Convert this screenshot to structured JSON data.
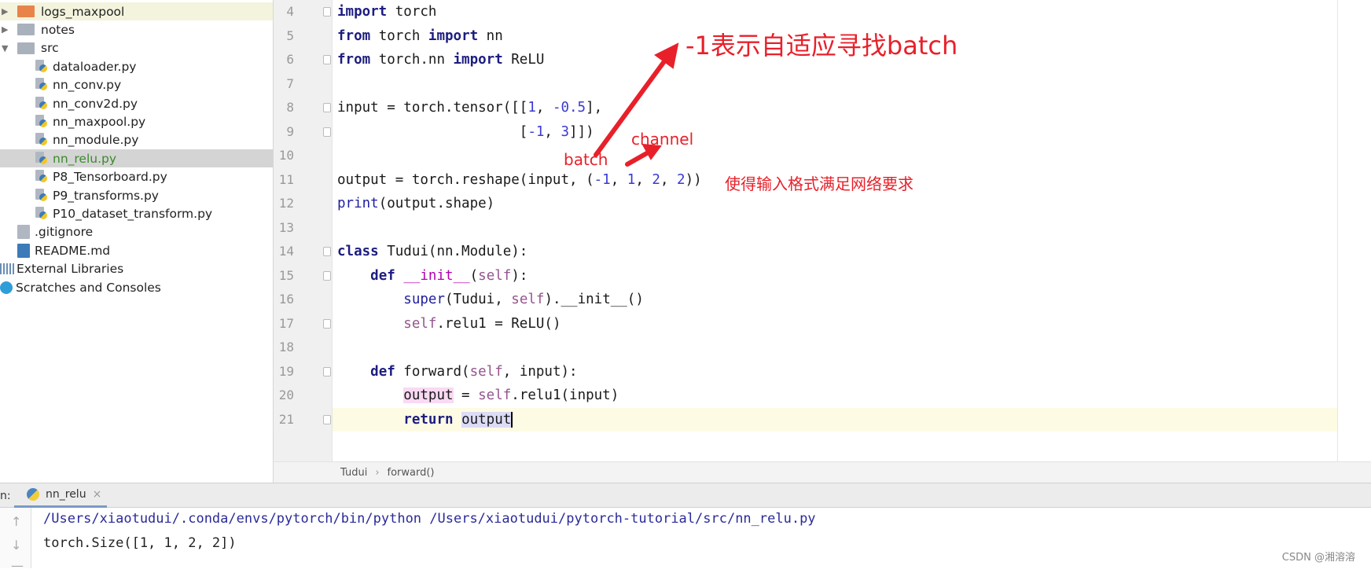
{
  "sidebar": {
    "items": [
      {
        "label": "logs_maxpool",
        "type": "folder",
        "color": "#e8844a",
        "expanded": false,
        "depth": 0,
        "highlight": true
      },
      {
        "label": "notes",
        "type": "folder",
        "color": "#a9b1bc",
        "expanded": false,
        "depth": 0
      },
      {
        "label": "src",
        "type": "folder",
        "color": "#a9b1bc",
        "expanded": true,
        "depth": 0
      },
      {
        "label": "dataloader.py",
        "type": "py",
        "depth": 2
      },
      {
        "label": "nn_conv.py",
        "type": "py",
        "depth": 2
      },
      {
        "label": "nn_conv2d.py",
        "type": "py",
        "depth": 2
      },
      {
        "label": "nn_maxpool.py",
        "type": "py",
        "depth": 2
      },
      {
        "label": "nn_module.py",
        "type": "py",
        "depth": 2
      },
      {
        "label": "nn_relu.py",
        "type": "py",
        "depth": 2,
        "selected": true
      },
      {
        "label": "P8_Tensorboard.py",
        "type": "py",
        "depth": 2
      },
      {
        "label": "P9_transforms.py",
        "type": "py",
        "depth": 2
      },
      {
        "label": "P10_dataset_transform.py",
        "type": "py",
        "depth": 2
      },
      {
        "label": ".gitignore",
        "type": "file",
        "depth": 1
      },
      {
        "label": "README.md",
        "type": "md",
        "depth": 1
      },
      {
        "label": "External Libraries",
        "type": "libs",
        "depth": -1
      },
      {
        "label": "Scratches and Consoles",
        "type": "scratch",
        "depth": -1
      }
    ]
  },
  "editor": {
    "lines": [
      {
        "n": "4",
        "fold": true,
        "tokens": [
          [
            "import",
            "kw"
          ],
          [
            " torch",
            ""
          ]
        ]
      },
      {
        "n": "5",
        "tokens": [
          [
            "from",
            "kw"
          ],
          [
            " torch ",
            ""
          ],
          [
            "import",
            "kw"
          ],
          [
            " nn",
            ""
          ]
        ]
      },
      {
        "n": "6",
        "fold": true,
        "tokens": [
          [
            "from",
            "kw"
          ],
          [
            " torch.nn ",
            ""
          ],
          [
            "import",
            "kw"
          ],
          [
            " ReLU",
            ""
          ]
        ]
      },
      {
        "n": "7",
        "tokens": []
      },
      {
        "n": "8",
        "fold": true,
        "tokens": [
          [
            "input = torch.tensor([[",
            ""
          ],
          [
            "1",
            "num"
          ],
          [
            ", ",
            ""
          ],
          [
            "-0.5",
            "num"
          ],
          [
            "],",
            ""
          ]
        ]
      },
      {
        "n": "9",
        "fold": true,
        "tokens": [
          [
            "                      [",
            ""
          ],
          [
            "-1",
            "num"
          ],
          [
            ", ",
            ""
          ],
          [
            "3",
            "num"
          ],
          [
            "]])",
            ""
          ]
        ]
      },
      {
        "n": "10",
        "tokens": []
      },
      {
        "n": "11",
        "tokens": [
          [
            "output = torch.reshape(input, (",
            ""
          ],
          [
            "-1",
            "num"
          ],
          [
            ", ",
            ""
          ],
          [
            "1",
            "num"
          ],
          [
            ", ",
            ""
          ],
          [
            "2",
            "num"
          ],
          [
            ", ",
            ""
          ],
          [
            "2",
            "num"
          ],
          [
            "))",
            ""
          ]
        ]
      },
      {
        "n": "12",
        "tokens": [
          [
            "print",
            "fn"
          ],
          [
            "(output.shape)",
            ""
          ]
        ]
      },
      {
        "n": "13",
        "tokens": []
      },
      {
        "n": "14",
        "fold": true,
        "tokens": [
          [
            "class",
            "kw"
          ],
          [
            " Tudui(nn.Module):",
            ""
          ]
        ]
      },
      {
        "n": "15",
        "fold": true,
        "tokens": [
          [
            "    ",
            ""
          ],
          [
            "def",
            "kw"
          ],
          [
            " ",
            ""
          ],
          [
            "__init__",
            "mag"
          ],
          [
            "(",
            ""
          ],
          [
            "self",
            "self"
          ],
          [
            "):",
            ""
          ]
        ]
      },
      {
        "n": "16",
        "tokens": [
          [
            "        ",
            ""
          ],
          [
            "super",
            "fn"
          ],
          [
            "(Tudui, ",
            ""
          ],
          [
            "self",
            "self"
          ],
          [
            ").__init__()",
            ""
          ]
        ]
      },
      {
        "n": "17",
        "fold": true,
        "tokens": [
          [
            "        ",
            ""
          ],
          [
            "self",
            "self"
          ],
          [
            ".relu1 = ReLU()",
            ""
          ]
        ]
      },
      {
        "n": "18",
        "tokens": []
      },
      {
        "n": "19",
        "fold": true,
        "tokens": [
          [
            "    ",
            ""
          ],
          [
            "def",
            "kw"
          ],
          [
            " forward(",
            ""
          ],
          [
            "self",
            "self"
          ],
          [
            ", input):",
            ""
          ]
        ]
      },
      {
        "n": "20",
        "tokens": [
          [
            "        ",
            ""
          ],
          [
            "output",
            "hp"
          ],
          [
            " = ",
            ""
          ],
          [
            "self",
            "self"
          ],
          [
            ".relu1(input)",
            ""
          ]
        ]
      },
      {
        "n": "21",
        "fold": true,
        "current": true,
        "tokens": [
          [
            "        ",
            ""
          ],
          [
            "return",
            "kw"
          ],
          [
            " ",
            ""
          ],
          [
            "output",
            "hv caret"
          ]
        ]
      }
    ],
    "breadcrumb": [
      "Tudui",
      "forward()"
    ],
    "breadcrumb_sep": "›"
  },
  "run": {
    "label": "n:",
    "tab": "nn_relu",
    "close": "×",
    "tools": [
      "↑",
      "↓",
      "—"
    ],
    "output": [
      {
        "text": "/Users/xiaotudui/.conda/envs/pytorch/bin/python /Users/xiaotudui/pytorch-tutorial/src/nn_relu.py",
        "color": "#2a2a9a"
      },
      {
        "text": "torch.Size([1, 1, 2, 2])",
        "color": "#222222"
      }
    ]
  },
  "annotations": {
    "title": "-1表示自适应寻找batch",
    "channel": "channel",
    "batch": "batch",
    "note": "使得输入格式满足网络要求",
    "color": "#e8202a"
  },
  "watermark": "CSDN @湘溶溶"
}
